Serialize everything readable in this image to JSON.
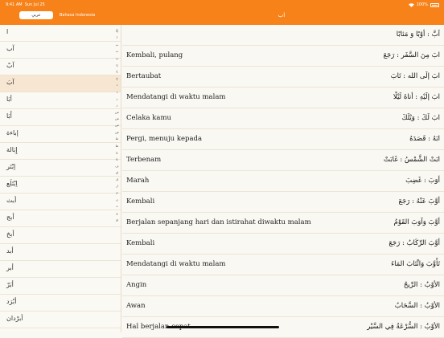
{
  "status": {
    "time": "9:41 AM",
    "date": "Sun Jul 25",
    "battery": "100%"
  },
  "segment": {
    "active": "عربي",
    "inactive": "Bahasa Indonesia"
  },
  "nav": {
    "title": "اب"
  },
  "sidebar": [
    "ا",
    "آب",
    "آبْ",
    "آبَ",
    "أبَا",
    "أَبَا",
    "إباءة",
    "إِبَالة",
    "اِبْتَر",
    "اِبْتَلَع",
    "أبث",
    "أبج",
    "أبخ",
    "أبد",
    "أبر",
    "أبَرّ",
    "أبْرَد",
    "أبرْدان"
  ],
  "index_letters": [
    "Q",
    "ا",
    "ب",
    "ت",
    "ث",
    "ج",
    "ح",
    "خ",
    "د",
    "ذ",
    "ر",
    "ز",
    "س",
    "ش",
    "ص",
    "ض",
    "ط",
    "ظ",
    "ع",
    "غ",
    "ف",
    "ق",
    "ك",
    "ل",
    "م",
    "ن",
    "ه",
    "و",
    "ي"
  ],
  "entries": [
    {
      "latin": "",
      "arabic": "اَبَّ : أوْبًا وَ مَئابًا"
    },
    {
      "latin": "Kembali, pulang",
      "arabic": "ابَ مِنَ السَّفَر : رَجَعَ"
    },
    {
      "latin": "Bertaubat",
      "arabic": "ابَ إلَى الله : تَابَ"
    },
    {
      "latin": "Mendatangi di waktu malam",
      "arabic": "ابَ إلَيْهِ : أتاهُ لَيْلًا"
    },
    {
      "latin": "Celaka kamu",
      "arabic": "ابَ لَكَ : وَيْلَكَ"
    },
    {
      "latin": "Pergi, menuju kepada",
      "arabic": "ابَهُ : قَصَدَهُ"
    },
    {
      "latin": "Terbenam",
      "arabic": "ابَتْ الشَّمْسُ : غَابَتْ"
    },
    {
      "latin": "Marah",
      "arabic": "أوَبَ : غَضِبَ"
    },
    {
      "latin": "Kembali",
      "arabic": "أوَّبَ عَنْهُ : رَجَعَ"
    },
    {
      "latin": "Berjalan sepanjang hari dan istirahat diwaktu malam",
      "arabic": "أوَّبَ وَآوَبَ القَوْمُ"
    },
    {
      "latin": "Kembali",
      "arabic": "أوَّبَ الرِّكَابُ : رَجَعَ"
    },
    {
      "latin": "Mendatangi di waktu malam",
      "arabic": "تَأَوَّبَ وَائْتَابَ المَاءَ"
    },
    {
      "latin": "Angin",
      "arabic": "الأوْبُ : الرِّيحُ"
    },
    {
      "latin": "Awan",
      "arabic": "الأوْبُ : السَّحَابُ"
    },
    {
      "latin": "Hal berjalan cepat",
      "arabic": "الأوْبُ : السُّرْعَةُ فِي السَّيْر"
    }
  ]
}
